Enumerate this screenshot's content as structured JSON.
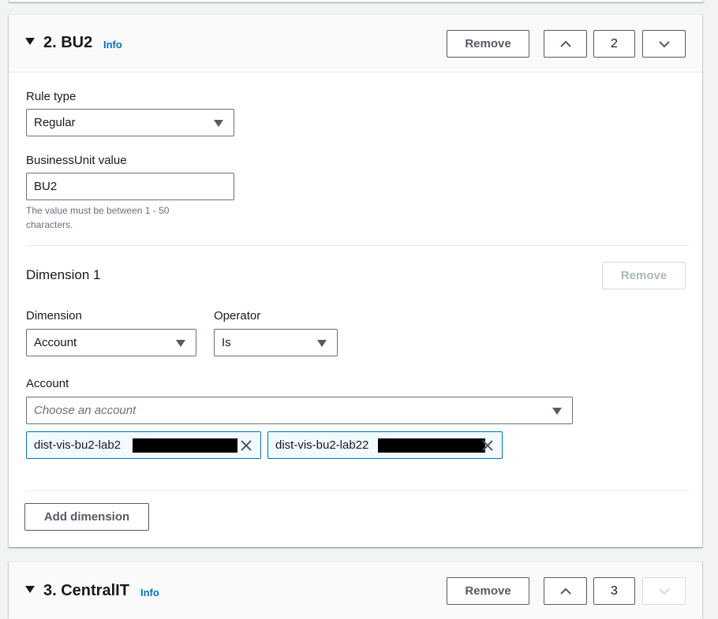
{
  "rule_2": {
    "title": "2. BU2",
    "info_label": "Info",
    "remove_label": "Remove",
    "order_value": "2",
    "rule_type": {
      "label": "Rule type",
      "selected": "Regular"
    },
    "business_unit": {
      "label": "BusinessUnit value",
      "value": "BU2",
      "hint": "The value must be between 1 - 50 characters."
    },
    "dimension_1": {
      "title": "Dimension 1",
      "remove_label": "Remove",
      "dimension": {
        "label": "Dimension",
        "selected": "Account"
      },
      "operator": {
        "label": "Operator",
        "selected": "Is"
      },
      "account": {
        "label": "Account",
        "placeholder": "Choose an account",
        "tokens": [
          {
            "label": "dist-vis-bu2-lab2"
          },
          {
            "label": "dist-vis-bu2-lab22"
          }
        ]
      }
    },
    "add_dimension_label": "Add dimension"
  },
  "rule_3": {
    "title": "3. CentralIT",
    "info_label": "Info",
    "remove_label": "Remove",
    "order_value": "3"
  }
}
